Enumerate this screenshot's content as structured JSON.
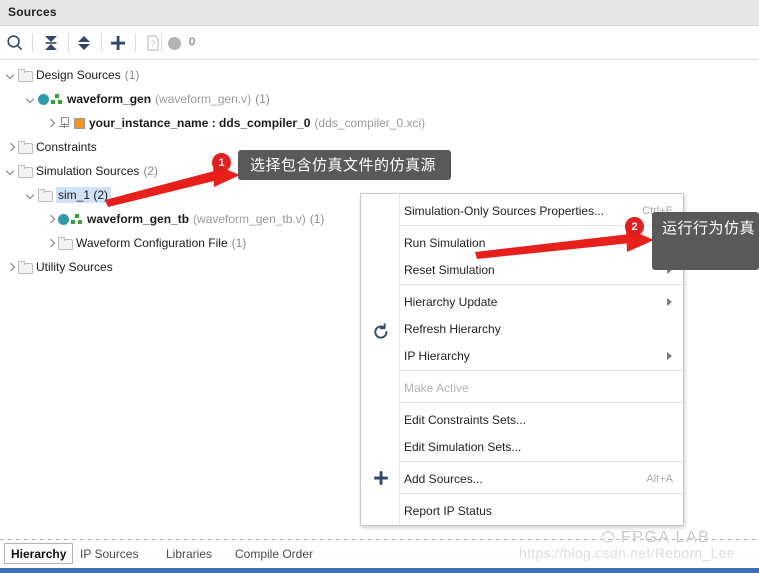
{
  "window": {
    "title": "Sources"
  },
  "toolbar": {
    "icons": [
      {
        "name": "search-icon",
        "label": "Search"
      },
      {
        "name": "collapse-all-icon",
        "label": "Collapse All"
      },
      {
        "name": "expand-all-icon",
        "label": "Expand All"
      },
      {
        "name": "add-sources-icon",
        "label": "Add Sources"
      },
      {
        "name": "report-icon",
        "label": "Report"
      }
    ],
    "count_badge": "0"
  },
  "tree": {
    "rows": [
      {
        "id": "design-sources",
        "indent": 0,
        "chevron": "down",
        "icon": "folder-icon",
        "label": "Design Sources",
        "count": "(1)",
        "bold": false,
        "selected": false
      },
      {
        "id": "waveform-gen",
        "indent": 1,
        "chevron": "down",
        "icon": "module-icon",
        "label": "waveform_gen",
        "dim": "(waveform_gen.v)",
        "count": "(1)",
        "bold": true,
        "selected": false
      },
      {
        "id": "your-instance-name",
        "indent": 2,
        "chevron": "right",
        "icon": "ip-xci-icon",
        "label": "your_instance_name : dds_compiler_0",
        "dim": "(dds_compiler_0.xci)",
        "bold": true,
        "selected": false
      },
      {
        "id": "constraints",
        "indent": 0,
        "chevron": "right",
        "icon": "folder-icon",
        "label": "Constraints",
        "bold": false,
        "selected": false
      },
      {
        "id": "simulation-sources",
        "indent": 0,
        "chevron": "down",
        "icon": "folder-icon",
        "label": "Simulation Sources",
        "count": "(2)",
        "bold": false,
        "selected": false
      },
      {
        "id": "sim-1",
        "indent": 1,
        "chevron": "down",
        "icon": "folder-icon",
        "label": "sim_1 (2)",
        "bold": false,
        "selected": true
      },
      {
        "id": "waveform-gen-tb",
        "indent": 2,
        "chevron": "right",
        "icon": "module-icon",
        "label": "waveform_gen_tb",
        "dim": "(waveform_gen_tb.v)",
        "count": "(1)",
        "bold": true,
        "selected": false
      },
      {
        "id": "waveform-configuration-file",
        "indent": 2,
        "chevron": "right",
        "icon": "folder-icon",
        "label": "Waveform Configuration File",
        "count": "(1)",
        "bold": false,
        "selected": false
      },
      {
        "id": "utility-sources",
        "indent": 0,
        "chevron": "right",
        "icon": "folder-icon",
        "label": "Utility Sources",
        "bold": false,
        "selected": false
      }
    ]
  },
  "context_menu": {
    "items": [
      {
        "id": "simulation-only-sources-properties",
        "label": "Simulation-Only Sources Properties...",
        "shortcut": "Ctrl+E",
        "submenu": false,
        "disabled": false,
        "icon": null
      },
      {
        "id": "run-simulation",
        "label": "Run Simulation",
        "shortcut": "",
        "submenu": true,
        "disabled": false,
        "icon": null
      },
      {
        "id": "reset-simulation",
        "label": "Reset Simulation",
        "shortcut": "",
        "submenu": true,
        "disabled": false,
        "icon": null
      },
      {
        "id": "hierarchy-update",
        "label": "Hierarchy Update",
        "shortcut": "",
        "submenu": true,
        "disabled": false,
        "icon": null
      },
      {
        "id": "refresh-hierarchy",
        "label": "Refresh Hierarchy",
        "shortcut": "",
        "submenu": false,
        "disabled": false,
        "icon": "refresh-icon"
      },
      {
        "id": "ip-hierarchy",
        "label": "IP Hierarchy",
        "shortcut": "",
        "submenu": true,
        "disabled": false,
        "icon": null
      },
      {
        "id": "make-active",
        "label": "Make Active",
        "shortcut": "",
        "submenu": false,
        "disabled": true,
        "icon": null
      },
      {
        "id": "edit-constraints-sets",
        "label": "Edit Constraints Sets...",
        "shortcut": "",
        "submenu": false,
        "disabled": false,
        "icon": null
      },
      {
        "id": "edit-simulation-sets",
        "label": "Edit Simulation Sets...",
        "shortcut": "",
        "submenu": false,
        "disabled": false,
        "icon": null
      },
      {
        "id": "add-sources",
        "label": "Add Sources...",
        "shortcut": "Alt+A",
        "submenu": false,
        "disabled": false,
        "icon": "plus-icon"
      },
      {
        "id": "report-ip-status",
        "label": "Report IP Status",
        "shortcut": "",
        "submenu": false,
        "disabled": false,
        "icon": null
      }
    ]
  },
  "annotations": {
    "callout1": {
      "badge": "1",
      "text": "选择包含仿真文件的仿真源"
    },
    "callout2": {
      "badge": "2",
      "text": "运行行为仿真"
    }
  },
  "watermark": {
    "logo": "FPGA LAB",
    "url": "https://blog.csdn.net/Reborn_Lee"
  },
  "bottom_tabs": [
    {
      "id": "hierarchy",
      "label": "Hierarchy",
      "active": true
    },
    {
      "id": "ip-sources",
      "label": "IP Sources",
      "active": false
    },
    {
      "id": "libraries",
      "label": "Libraries",
      "active": false
    },
    {
      "id": "compile-order",
      "label": "Compile Order",
      "active": false
    }
  ],
  "colors": {
    "accent": "#3f6fb5",
    "selection": "#cfe2f7",
    "callout_bg": "#595959",
    "badge_red": "#e02020",
    "arrow_red": "#e8201b",
    "module_teal": "#2f9aa8",
    "module_green": "#3aa03a",
    "xci_orange": "#f29222"
  }
}
